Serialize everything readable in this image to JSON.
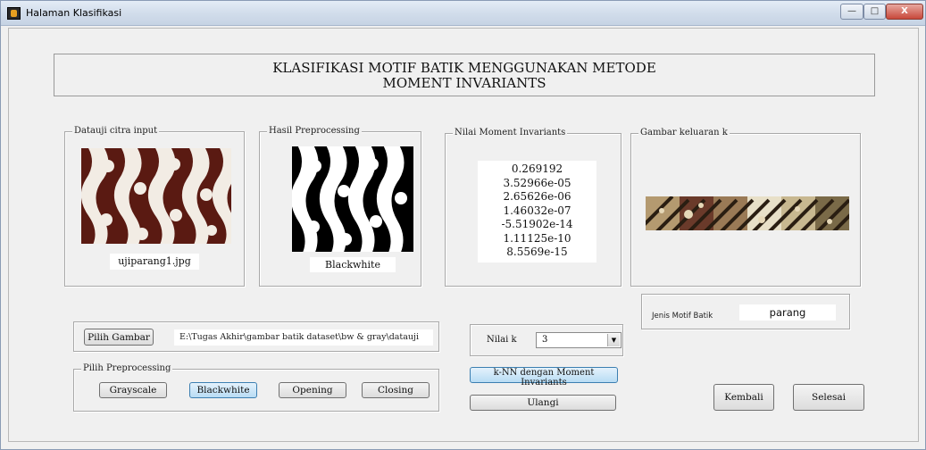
{
  "window": {
    "title": "Halaman Klasifikasi",
    "min_label": "—",
    "max_label": "□",
    "close_label": "X"
  },
  "header": {
    "line1": "KLASIFIKASI MOTIF BATIK MENGGUNAKAN METODE",
    "line2": "MOMENT INVARIANTS"
  },
  "input_panel": {
    "legend": "Datauji citra input",
    "filename": "ujiparang1.jpg"
  },
  "preprocess_panel": {
    "legend": "Hasil Preprocessing",
    "caption": "Blackwhite"
  },
  "moment_panel": {
    "legend": "Nilai Moment Invariants",
    "values": [
      "0.269192",
      "3.52966e-05",
      "2.65626e-06",
      "1.46032e-07",
      "-5.51902e-14",
      "1.11125e-10",
      "8.5569e-15"
    ]
  },
  "output_panel": {
    "legend": "Gambar keluaran k"
  },
  "result": {
    "label": "Jenis Motif Batik",
    "value": "parang"
  },
  "file": {
    "button": "Pilih Gambar",
    "path": "E:\\Tugas Akhir\\gambar batik dataset\\bw & gray\\datauji"
  },
  "preprocessing": {
    "legend": "Pilih Preprocessing",
    "buttons": [
      "Grayscale",
      "Blackwhite",
      "Opening",
      "Closing"
    ],
    "active": "Blackwhite"
  },
  "knn": {
    "k_label": "Nilai k",
    "k_value": "3",
    "run_button": "k-NN dengan Moment Invariants",
    "reset_button": "Ulangi"
  },
  "nav": {
    "back_button": "Kembali",
    "finish_button": "Selesai"
  },
  "colors": {
    "batik_bg": "#5a1a12",
    "batik_motif": "#f2ece4",
    "active_button": "#b8dcf4"
  }
}
